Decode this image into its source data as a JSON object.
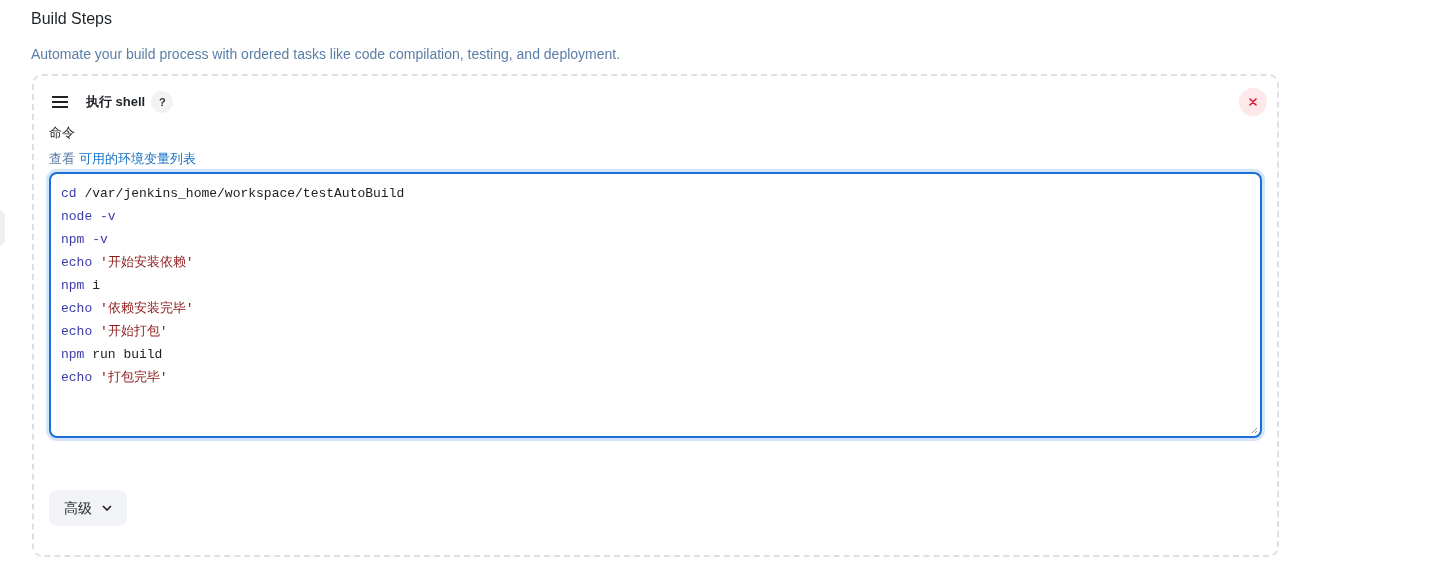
{
  "section": {
    "title": "Build Steps",
    "description": "Automate your build process with ordered tasks like code compilation, testing, and deployment."
  },
  "step": {
    "title": "执行 shell",
    "help": "?",
    "field_label": "命令",
    "hint_prefix": "查看",
    "hint_link": "可用的环境变量列表",
    "script_lines": [
      [
        {
          "kind": "command",
          "text": "cd"
        },
        {
          "kind": "plain",
          "text": " /var/jenkins_home/workspace/testAutoBuild"
        }
      ],
      [
        {
          "kind": "command",
          "text": "node -v"
        }
      ],
      [
        {
          "kind": "command",
          "text": "npm -v"
        }
      ],
      [
        {
          "kind": "command",
          "text": "echo "
        },
        {
          "kind": "string",
          "text": "'开始安装依赖'"
        }
      ],
      [
        {
          "kind": "command",
          "text": "npm"
        },
        {
          "kind": "plain",
          "text": " i"
        }
      ],
      [
        {
          "kind": "command",
          "text": "echo "
        },
        {
          "kind": "string",
          "text": "'依赖安装完毕'"
        }
      ],
      [
        {
          "kind": "command",
          "text": "echo "
        },
        {
          "kind": "string",
          "text": "'开始打包'"
        }
      ],
      [
        {
          "kind": "command",
          "text": "npm"
        },
        {
          "kind": "plain",
          "text": " run build"
        }
      ],
      [
        {
          "kind": "command",
          "text": "echo "
        },
        {
          "kind": "string",
          "text": "'打包完毕'"
        }
      ]
    ],
    "advanced_button": "高级"
  }
}
